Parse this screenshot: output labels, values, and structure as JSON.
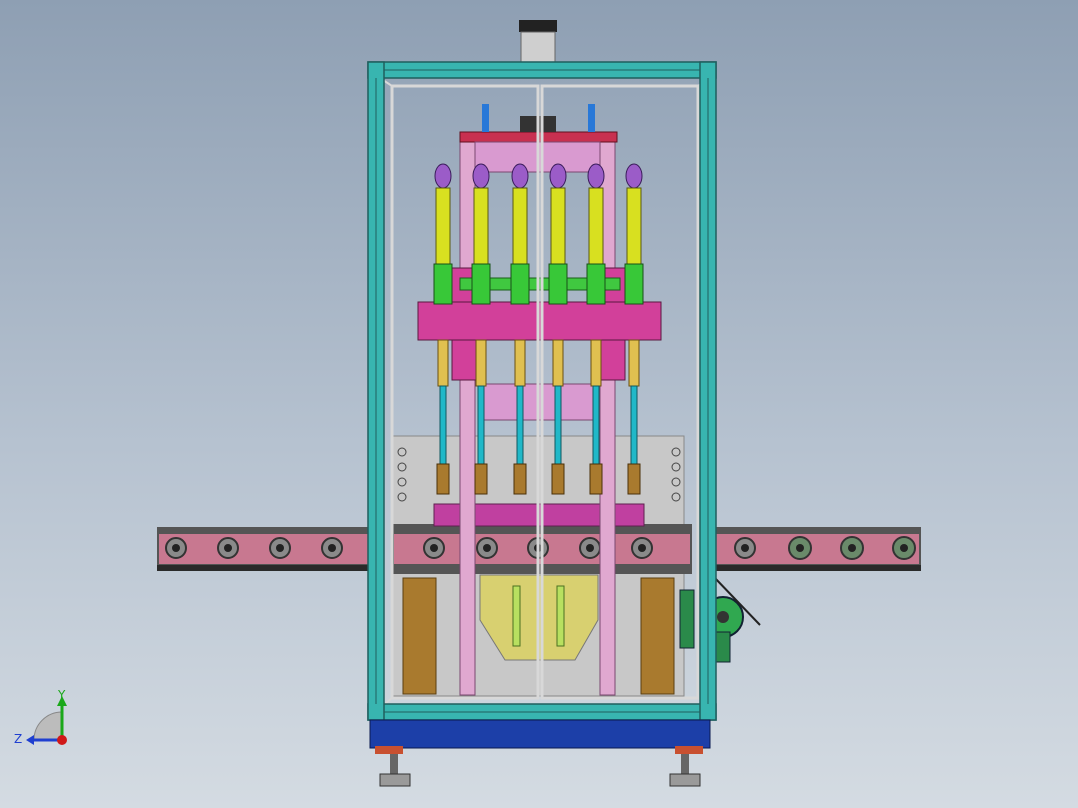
{
  "viewport": {
    "model": "filling-machine-assembly",
    "view": "front"
  },
  "triad": {
    "y_label": "Y",
    "z_label": "Z",
    "y_color": "#1aa81a",
    "z_color": "#1f3fd0",
    "origin_color": "#d01818"
  },
  "colors": {
    "frame": "#38b5b0",
    "frame_dark": "#1f7a78",
    "glass_edge": "#d8d8d8",
    "pink_plate": "#d2409a",
    "pink_light": "#d99ad0",
    "purple": "#9b5cc8",
    "yellow_green": "#d8e020",
    "green": "#38c838",
    "cyan": "#20b8c8",
    "base_blue": "#1c3fa8",
    "conveyor": "#c87890",
    "brown": "#a97a2e",
    "panel_gray": "#c8c8c8"
  }
}
